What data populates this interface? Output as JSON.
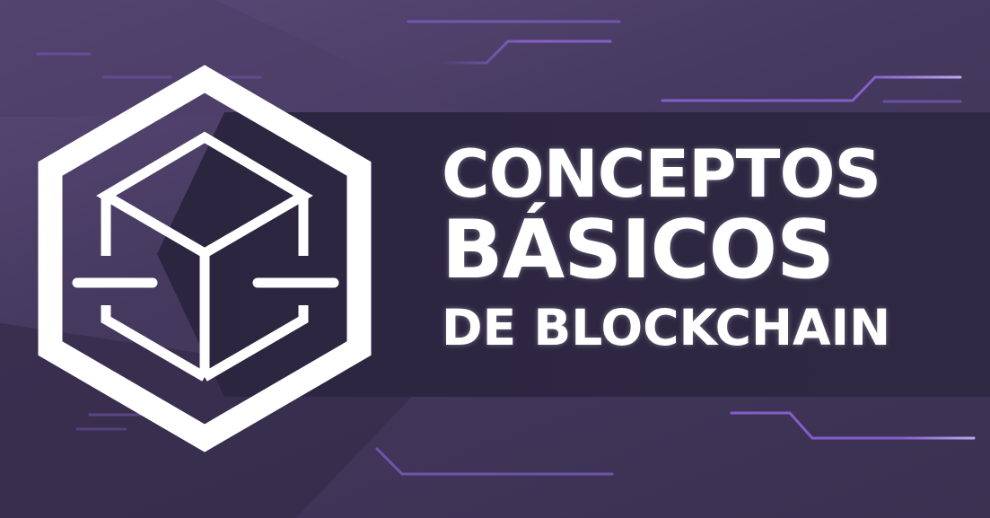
{
  "title": {
    "line1": "CONCEPTOS",
    "line2": "BÁSICOS",
    "line3": "DE BLOCKCHAIN"
  },
  "logo": {
    "icon": "blockchain-cube-hexagon-icon"
  },
  "colors": {
    "background": "#45395f",
    "band": "#2f2843",
    "text": "#ffffff",
    "accent_lines": "#8b63d6"
  }
}
